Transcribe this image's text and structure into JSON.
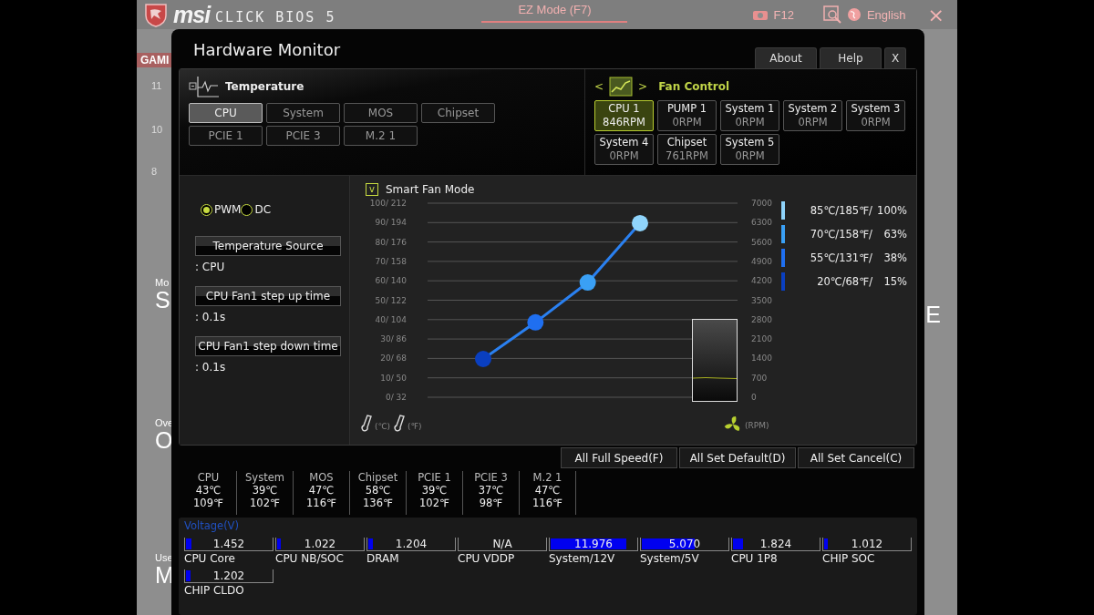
{
  "header": {
    "logo": "msi",
    "product": "CLICK BIOS 5",
    "mode_button": "EZ Mode (F7)",
    "screenshot_key": "F12",
    "language": "English",
    "close": "×"
  },
  "background_fragments": {
    "left": [
      {
        "text": "GAMI",
        "kind": "tab"
      },
      {
        "text": "11",
        "kind": "small"
      },
      {
        "text": "10",
        "kind": "small"
      },
      {
        "text": "8",
        "kind": "small"
      },
      {
        "text": "Mo",
        "kind": "caption"
      },
      {
        "text": "S",
        "kind": "big"
      },
      {
        "text": "Ove",
        "kind": "caption"
      },
      {
        "text": "O",
        "kind": "big"
      },
      {
        "text": "Use",
        "kind": "caption"
      },
      {
        "text": "M",
        "kind": "big"
      }
    ],
    "right": [
      {
        "text": "E",
        "kind": "big"
      }
    ]
  },
  "window": {
    "title": "Hardware Monitor",
    "buttons": [
      "About",
      "Help",
      "X"
    ]
  },
  "temperature": {
    "title": "Temperature",
    "sources": [
      {
        "label": "CPU",
        "selected": true
      },
      {
        "label": "System",
        "selected": false
      },
      {
        "label": "MOS",
        "selected": false
      },
      {
        "label": "Chipset",
        "selected": false
      },
      {
        "label": "PCIE 1",
        "selected": false
      },
      {
        "label": "PCIE 3",
        "selected": false
      },
      {
        "label": "M.2 1",
        "selected": false
      }
    ]
  },
  "fan_control": {
    "prev": "<",
    "next": ">",
    "title": "Fan Control",
    "fans": [
      {
        "name": "CPU 1",
        "speed": "846RPM",
        "selected": true
      },
      {
        "name": "PUMP 1",
        "speed": "0RPM",
        "selected": false
      },
      {
        "name": "System 1",
        "speed": "0RPM",
        "selected": false
      },
      {
        "name": "System 2",
        "speed": "0RPM",
        "selected": false
      },
      {
        "name": "System 3",
        "speed": "0RPM",
        "selected": false
      },
      {
        "name": "System 4",
        "speed": "0RPM",
        "selected": false
      },
      {
        "name": "Chipset",
        "speed": "761RPM",
        "selected": false
      },
      {
        "name": "System 5",
        "speed": "0RPM",
        "selected": false
      }
    ]
  },
  "fan_settings": {
    "modes": [
      {
        "label": "PWM",
        "selected": true
      },
      {
        "label": "DC",
        "selected": false
      }
    ],
    "fields": [
      {
        "label": "Temperature Source",
        "value": ": CPU"
      },
      {
        "label": "CPU Fan1 step up time",
        "value": ": 0.1s"
      },
      {
        "label": "CPU Fan1 step down time",
        "value": ": 0.1s"
      }
    ]
  },
  "smart_fan": {
    "label": "Smart Fan Mode",
    "checked": true,
    "check_glyph": "v",
    "temperature_ticks": [
      "100/ 212",
      "90/ 194",
      "80/ 176",
      "70/ 158",
      "60/ 140",
      "50/ 122",
      "40/ 104",
      "30/  86",
      "20/  68",
      "10/  50",
      "0/  32"
    ],
    "chart_data": {
      "type": "line",
      "categories": [
        null,
        null,
        null,
        null
      ],
      "ylim": [
        0,
        7000
      ],
      "grid": true,
      "yticks": [
        7000,
        6300,
        5600,
        4900,
        4200,
        3500,
        2800,
        2100,
        1400,
        700,
        0
      ],
      "series": [
        {
          "color": "#2a80f0",
          "marker": true,
          "values": [
            1380,
            2700,
            4140,
            6280
          ]
        }
      ]
    },
    "celsius_unit": "(℃)",
    "fahrenheit_unit": "(℉)",
    "rpm_unit": "(RPM)",
    "legend": [
      {
        "temp": "85℃/185℉/",
        "percent": "100%",
        "color": "#8fd4fb"
      },
      {
        "temp": "70℃/158℉/",
        "percent": "63%",
        "color": "#3aa0f5"
      },
      {
        "temp": "55℃/131℉/",
        "percent": "38%",
        "color": "#1f6ff0"
      },
      {
        "temp": "20℃/68℉/",
        "percent": "15%",
        "color": "#0a3fc0"
      }
    ]
  },
  "actions": [
    "All Full Speed(F)",
    "All Set Default(D)",
    "All Set Cancel(C)"
  ],
  "readings": [
    {
      "name": "CPU",
      "celsius": "43℃",
      "fahrenheit": "109℉"
    },
    {
      "name": "System",
      "celsius": "39℃",
      "fahrenheit": "102℉"
    },
    {
      "name": "MOS",
      "celsius": "47℃",
      "fahrenheit": "116℉"
    },
    {
      "name": "Chipset",
      "celsius": "58℃",
      "fahrenheit": "136℉"
    },
    {
      "name": "PCIE 1",
      "celsius": "39℃",
      "fahrenheit": "102℉"
    },
    {
      "name": "PCIE 3",
      "celsius": "37℃",
      "fahrenheit": "98℉"
    },
    {
      "name": "M.2 1",
      "celsius": "47℃",
      "fahrenheit": "116℉"
    }
  ],
  "voltage": {
    "title": "Voltage(V)",
    "items": [
      {
        "name": "CPU Core",
        "reading": "1.452",
        "level": 0.06
      },
      {
        "name": "CPU NB/SOC",
        "reading": "1.022",
        "level": 0.04
      },
      {
        "name": "DRAM",
        "reading": "1.204",
        "level": 0.05
      },
      {
        "name": "CPU VDDP",
        "reading": "N/A",
        "level": 0
      },
      {
        "name": "System/12V",
        "reading": "11.976",
        "level": 0.86
      },
      {
        "name": "System/5V",
        "reading": "5.070",
        "level": 0.6
      },
      {
        "name": "CPU 1P8",
        "reading": "1.824",
        "level": 0.11
      },
      {
        "name": "CHIP SOC",
        "reading": "1.012",
        "level": 0.04
      },
      {
        "name": "CHIP CLDO",
        "reading": "1.202",
        "level": 0.05
      }
    ]
  }
}
